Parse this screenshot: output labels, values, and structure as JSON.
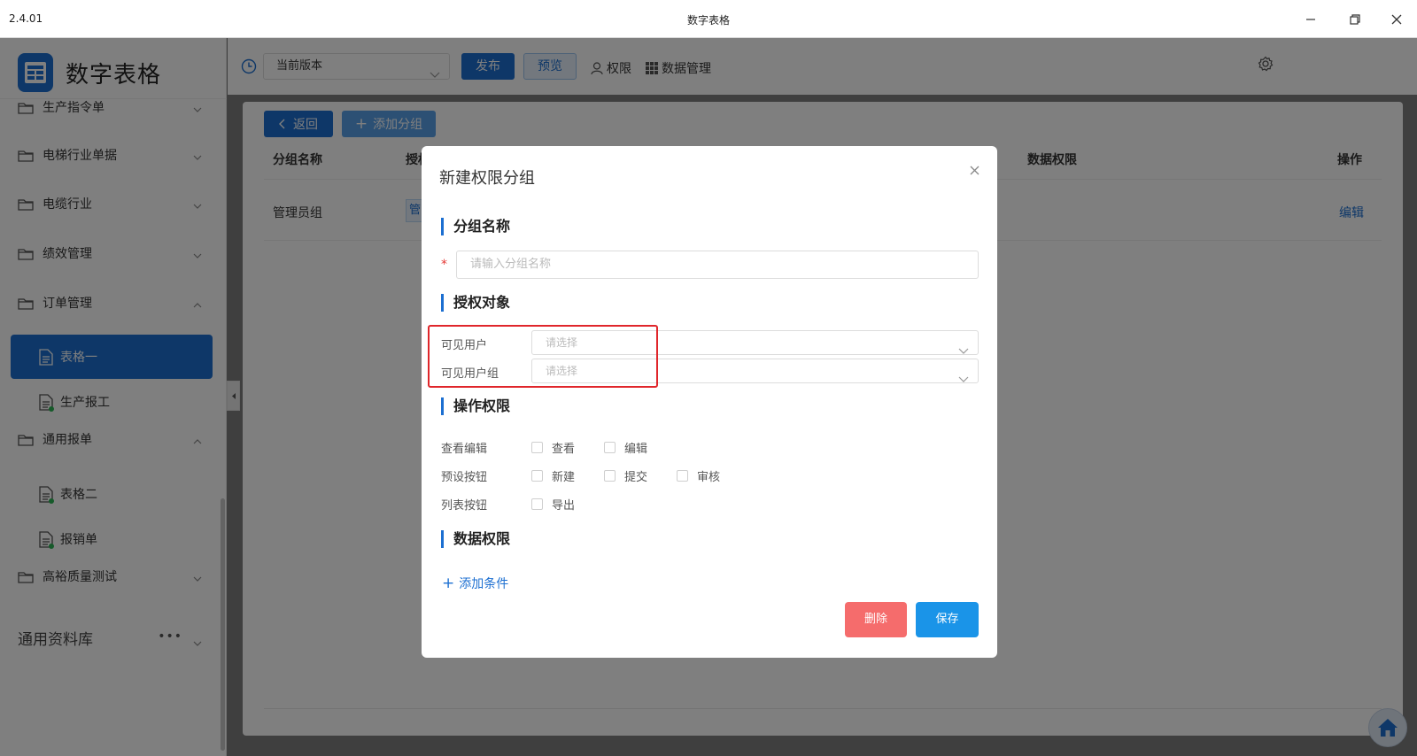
{
  "window": {
    "version": "2.4.01",
    "title": "数字表格"
  },
  "sidebar": {
    "logo_text": "数字表格",
    "items": [
      {
        "label": "生产指令单",
        "expanded": false
      },
      {
        "label": "电梯行业单据",
        "expanded": false
      },
      {
        "label": "电缆行业",
        "expanded": false
      },
      {
        "label": "绩效管理",
        "expanded": false
      },
      {
        "label": "订单管理",
        "expanded": true
      },
      {
        "label": "通用报单",
        "expanded": true
      },
      {
        "label": "高裕质量测试",
        "expanded": false
      }
    ],
    "sub_items": [
      {
        "label": "表格一",
        "active": true
      },
      {
        "label": "生产报工",
        "active": false
      },
      {
        "label": "表格二",
        "active": false
      },
      {
        "label": "报销单",
        "active": false
      }
    ],
    "library": {
      "label": "通用资料库",
      "more": "•••"
    }
  },
  "toolbar": {
    "version_select": "当前版本",
    "publish": "发布",
    "preview": "预览",
    "permission": "权限",
    "data_mgmt": "数据管理"
  },
  "content": {
    "back": "返回",
    "add_group": "添加分组",
    "columns": {
      "group_name": "分组名称",
      "auth": "授权",
      "data_perm": "数据权限",
      "action": "操作"
    },
    "row": {
      "name": "管理员组",
      "tag": "管",
      "edit": "编辑"
    }
  },
  "modal": {
    "title": "新建权限分组",
    "sections": {
      "group_name": "分组名称",
      "auth_target": "授权对象",
      "op_perm": "操作权限",
      "data_perm": "数据权限"
    },
    "required_mark": "*",
    "group_name_placeholder": "请输入分组名称",
    "visible_users": {
      "label": "可见用户",
      "placeholder": "请选择"
    },
    "visible_groups": {
      "label": "可见用户组",
      "placeholder": "请选择"
    },
    "perm_rows": [
      {
        "label": "查看编辑",
        "options": [
          "查看",
          "编辑"
        ]
      },
      {
        "label": "预设按钮",
        "options": [
          "新建",
          "提交",
          "审核"
        ]
      },
      {
        "label": "列表按钮",
        "options": [
          "导出"
        ]
      }
    ],
    "add_condition": "添加条件",
    "delete": "删除",
    "save": "保存"
  },
  "colors": {
    "primary": "#1c6fd1",
    "danger": "#f56c6c",
    "save": "#1a94e8",
    "highlight": "#e0262b"
  }
}
